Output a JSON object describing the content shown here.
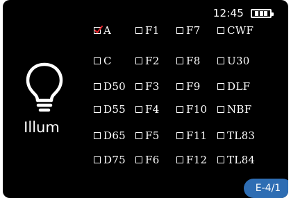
{
  "status": {
    "time": "12:45",
    "battery_icon": "battery-full-icon",
    "battery_level": 1.0
  },
  "sidebar": {
    "icon": "lightbulb-icon",
    "label": "Illum"
  },
  "illuminants": [
    [
      {
        "label": "A",
        "checked": true
      },
      {
        "label": "F1",
        "checked": false
      },
      {
        "label": "F7",
        "checked": false
      },
      {
        "label": "CWF",
        "checked": false
      }
    ],
    [
      {
        "label": "C",
        "checked": false
      },
      {
        "label": "F2",
        "checked": false
      },
      {
        "label": "F8",
        "checked": false
      },
      {
        "label": "U30",
        "checked": false
      }
    ],
    [
      {
        "label": "D50",
        "checked": false
      },
      {
        "label": "F3",
        "checked": false
      },
      {
        "label": "F9",
        "checked": false
      },
      {
        "label": "DLF",
        "checked": false
      }
    ],
    [
      {
        "label": "D55",
        "checked": false
      },
      {
        "label": "F4",
        "checked": false
      },
      {
        "label": "F10",
        "checked": false
      },
      {
        "label": "NBF",
        "checked": false
      }
    ],
    [
      {
        "label": "D65",
        "checked": false
      },
      {
        "label": "F5",
        "checked": false
      },
      {
        "label": "F11",
        "checked": false
      },
      {
        "label": "TL83",
        "checked": false
      }
    ],
    [
      {
        "label": "D75",
        "checked": false
      },
      {
        "label": "F6",
        "checked": false
      },
      {
        "label": "F12",
        "checked": false
      },
      {
        "label": "TL84",
        "checked": false
      }
    ]
  ],
  "page_indicator": "E-4/1",
  "colors": {
    "background": "#000000",
    "text": "#ffffff",
    "check_mark": "#e0262e",
    "badge": "#2e6db3"
  }
}
